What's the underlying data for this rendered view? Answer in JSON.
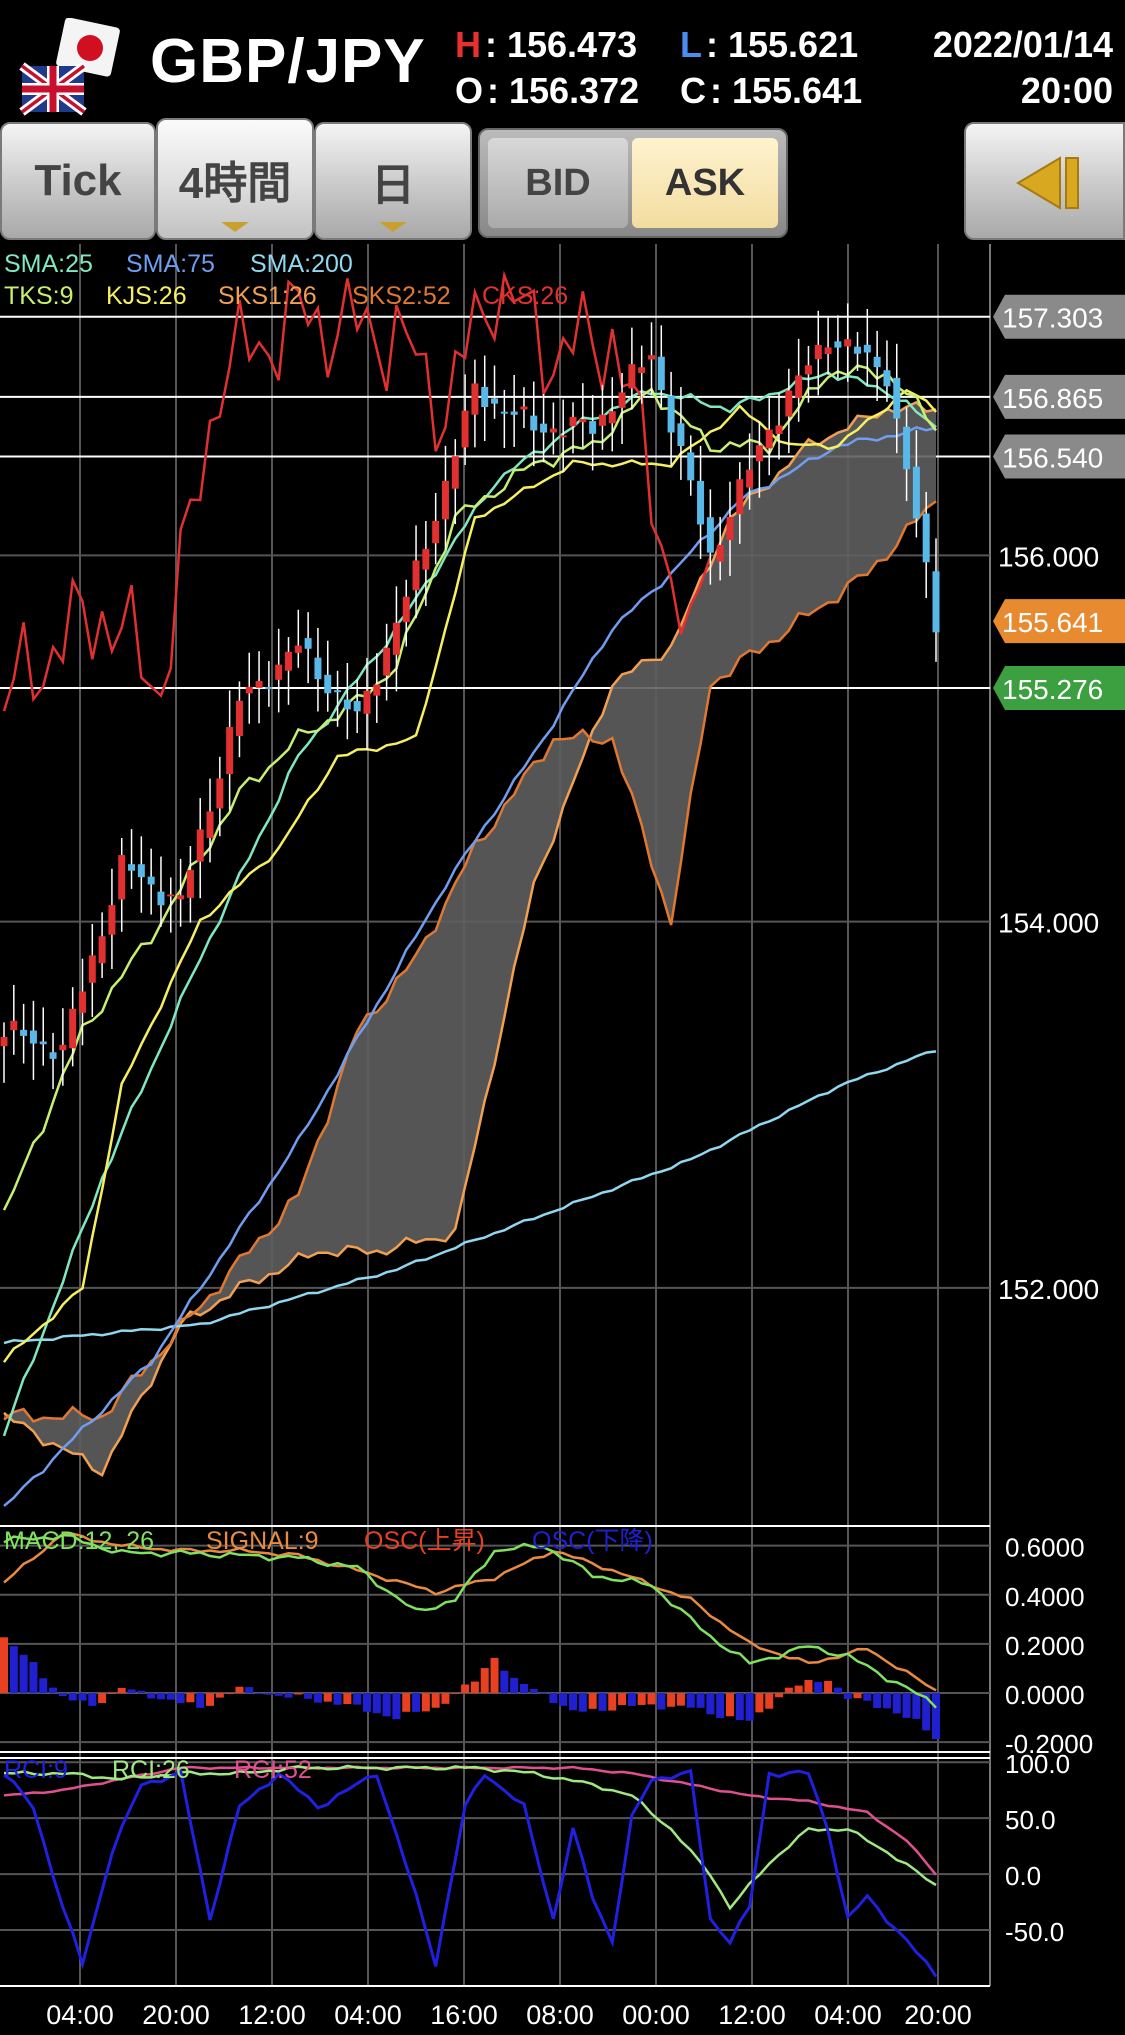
{
  "header": {
    "pair": "GBP/JPY",
    "high_key": "H",
    "high": ": 156.473",
    "low_key": "L",
    "low": ": 155.621",
    "open_key": "O",
    "open": ": 156.372",
    "close_key": "C",
    "close": ": 155.641",
    "date": "2022/01/14",
    "time": "20:00"
  },
  "toolbar": {
    "tabs": [
      "Tick",
      "4時間",
      "日"
    ],
    "selected_tab": "4時間",
    "bid_label": "BID",
    "ask_label": "ASK",
    "selected_side": "ASK"
  },
  "colors": {
    "sma25": "#7fe8c0",
    "sma75": "#6f9df0",
    "sma200": "#8fd8f0",
    "tks": "#c8f070",
    "kjs": "#f6f060",
    "sks1": "#f0a050",
    "sks2": "#e07830",
    "cks": "#e03030",
    "candle_up": "#e03030",
    "candle_down": "#58b8e8",
    "macd": "#80e060",
    "signal": "#e88a40",
    "osc_up": "#e84020",
    "osc_down": "#2020d0",
    "rci9": "#2020e0",
    "rci26": "#a0e880",
    "rci52": "#e05090",
    "close_tag": "#e88a30",
    "low_tag": "#3ca040"
  },
  "chart_data": [
    {
      "type": "candlestick",
      "title": "",
      "indicators_row1": [
        "SMA:25",
        "SMA:75",
        "SMA:200"
      ],
      "indicators_row2": [
        "TKS:9",
        "KJS:26",
        "SKS1:26",
        "SKS2:52",
        "CKS:26"
      ],
      "x_ticks": [
        "04:00",
        "20:00",
        "12:00",
        "04:00",
        "16:00",
        "08:00",
        "00:00",
        "12:00",
        "04:00",
        "20:00"
      ],
      "y_ticks": [
        "154.000",
        "152.000"
      ],
      "ylim": [
        150.7,
        157.7
      ],
      "price_tags": [
        {
          "label": "157.303",
          "value": 157.303,
          "style": "gray"
        },
        {
          "label": "156.865",
          "value": 156.865,
          "style": "gray"
        },
        {
          "label": "156.540",
          "value": 156.54,
          "style": "gray"
        },
        {
          "label": "156.000",
          "value": 156.0,
          "style": "plain"
        },
        {
          "label": "155.641",
          "value": 155.641,
          "style": "close"
        },
        {
          "label": "155.276",
          "value": 155.276,
          "style": "low"
        }
      ],
      "hlines": [
        157.303,
        156.865,
        156.54,
        155.276
      ],
      "anchors": {
        "close": [
          [
            0,
            153.4
          ],
          [
            6,
            153.3
          ],
          [
            12,
            154.3
          ],
          [
            18,
            154.1
          ],
          [
            24,
            155.2
          ],
          [
            30,
            155.5
          ],
          [
            36,
            155.1
          ],
          [
            42,
            155.9
          ],
          [
            48,
            156.9
          ],
          [
            54,
            156.7
          ],
          [
            60,
            156.7
          ],
          [
            66,
            157.1
          ],
          [
            72,
            156.0
          ],
          [
            78,
            156.7
          ],
          [
            84,
            157.2
          ],
          [
            90,
            157.0
          ],
          [
            95,
            155.64
          ]
        ],
        "sma25": [
          [
            0,
            151.2
          ],
          [
            10,
            152.6
          ],
          [
            20,
            153.8
          ],
          [
            30,
            154.9
          ],
          [
            40,
            155.6
          ],
          [
            50,
            156.4
          ],
          [
            58,
            156.7
          ],
          [
            66,
            156.9
          ],
          [
            74,
            156.8
          ],
          [
            84,
            157.0
          ],
          [
            90,
            156.9
          ],
          [
            95,
            156.7
          ]
        ],
        "sma75": [
          [
            0,
            150.8
          ],
          [
            15,
            151.6
          ],
          [
            30,
            152.8
          ],
          [
            45,
            154.2
          ],
          [
            55,
            155.0
          ],
          [
            62,
            155.6
          ],
          [
            68,
            155.9
          ],
          [
            75,
            156.3
          ],
          [
            85,
            156.6
          ],
          [
            95,
            156.7
          ]
        ],
        "sma200": [
          [
            0,
            151.7
          ],
          [
            20,
            151.8
          ],
          [
            40,
            152.1
          ],
          [
            55,
            152.4
          ],
          [
            70,
            152.7
          ],
          [
            85,
            153.1
          ],
          [
            95,
            153.3
          ]
        ],
        "tks": [
          [
            0,
            152.4
          ],
          [
            8,
            153.4
          ],
          [
            16,
            154.0
          ],
          [
            24,
            154.7
          ],
          [
            30,
            155.0
          ],
          [
            36,
            155.2
          ],
          [
            40,
            155.4
          ],
          [
            46,
            156.2
          ],
          [
            54,
            156.5
          ],
          [
            60,
            156.6
          ],
          [
            66,
            156.9
          ],
          [
            72,
            156.6
          ],
          [
            78,
            156.6
          ],
          [
            84,
            157.0
          ],
          [
            90,
            157.0
          ],
          [
            95,
            156.7
          ]
        ],
        "kjs": [
          [
            0,
            151.6
          ],
          [
            8,
            152.0
          ],
          [
            12,
            153.1
          ],
          [
            20,
            154.0
          ],
          [
            28,
            154.4
          ],
          [
            34,
            154.9
          ],
          [
            42,
            155.0
          ],
          [
            48,
            156.2
          ],
          [
            58,
            156.5
          ],
          [
            68,
            156.5
          ],
          [
            75,
            156.8
          ],
          [
            80,
            156.6
          ],
          [
            85,
            156.6
          ],
          [
            92,
            156.9
          ],
          [
            95,
            156.8
          ]
        ],
        "sks1": [
          [
            0,
            151.3
          ],
          [
            10,
            151.0
          ],
          [
            18,
            151.8
          ],
          [
            24,
            152.0
          ],
          [
            32,
            152.2
          ],
          [
            38,
            152.2
          ],
          [
            46,
            152.3
          ],
          [
            54,
            154.2
          ],
          [
            62,
            155.3
          ],
          [
            68,
            155.5
          ],
          [
            74,
            156.2
          ],
          [
            82,
            156.6
          ],
          [
            90,
            156.8
          ],
          [
            95,
            156.8
          ]
        ],
        "sks2": [
          [
            0,
            151.3
          ],
          [
            10,
            151.3
          ],
          [
            20,
            151.9
          ],
          [
            30,
            152.5
          ],
          [
            36,
            153.4
          ],
          [
            42,
            153.8
          ],
          [
            48,
            154.4
          ],
          [
            56,
            155.0
          ],
          [
            62,
            155.0
          ],
          [
            68,
            154.0
          ],
          [
            72,
            155.3
          ],
          [
            80,
            155.6
          ],
          [
            88,
            155.9
          ],
          [
            95,
            156.3
          ]
        ],
        "cks": [
          [
            0,
            155.2
          ],
          [
            5,
            155.5
          ],
          [
            10,
            155.7
          ],
          [
            16,
            155.3
          ],
          [
            22,
            157.0
          ],
          [
            30,
            157.3
          ],
          [
            40,
            157.2
          ],
          [
            45,
            156.8
          ],
          [
            50,
            157.5
          ],
          [
            56,
            157.1
          ],
          [
            62,
            157.2
          ],
          [
            66,
            156.4
          ],
          [
            70,
            155.4
          ],
          [
            72,
            156.2
          ]
        ]
      }
    },
    {
      "type": "line+bar",
      "title": "",
      "legend": [
        "MACD:12, 26",
        "SIGNAL:9",
        "OSC(上昇)",
        "OSC(下降)"
      ],
      "y_ticks": [
        "0.6000",
        "0.4000",
        "0.2000",
        "0.0000",
        "-0.2000"
      ],
      "ylim": [
        -0.24,
        0.68
      ],
      "anchors": {
        "macd": [
          [
            0,
            0.62
          ],
          [
            6,
            0.64
          ],
          [
            12,
            0.57
          ],
          [
            18,
            0.57
          ],
          [
            24,
            0.56
          ],
          [
            30,
            0.55
          ],
          [
            36,
            0.51
          ],
          [
            42,
            0.33
          ],
          [
            46,
            0.38
          ],
          [
            50,
            0.58
          ],
          [
            55,
            0.6
          ],
          [
            60,
            0.48
          ],
          [
            66,
            0.44
          ],
          [
            72,
            0.23
          ],
          [
            76,
            0.12
          ],
          [
            82,
            0.19
          ],
          [
            86,
            0.15
          ],
          [
            92,
            0.02
          ],
          [
            95,
            -0.05
          ]
        ],
        "signal": [
          [
            0,
            0.45
          ],
          [
            6,
            0.65
          ],
          [
            12,
            0.6
          ],
          [
            18,
            0.58
          ],
          [
            24,
            0.58
          ],
          [
            30,
            0.56
          ],
          [
            36,
            0.5
          ],
          [
            44,
            0.41
          ],
          [
            50,
            0.47
          ],
          [
            56,
            0.58
          ],
          [
            62,
            0.5
          ],
          [
            70,
            0.38
          ],
          [
            76,
            0.2
          ],
          [
            82,
            0.12
          ],
          [
            88,
            0.18
          ],
          [
            95,
            0.01
          ]
        ],
        "osc": [
          [
            0,
            0.22
          ],
          [
            3,
            0.12
          ],
          [
            6,
            -0.02
          ],
          [
            9,
            -0.05
          ],
          [
            12,
            0.02
          ],
          [
            16,
            -0.02
          ],
          [
            20,
            -0.06
          ],
          [
            24,
            0.02
          ],
          [
            28,
            -0.01
          ],
          [
            34,
            -0.04
          ],
          [
            40,
            -0.1
          ],
          [
            44,
            -0.06
          ],
          [
            48,
            0.05
          ],
          [
            50,
            0.15
          ],
          [
            52,
            0.05
          ],
          [
            55,
            0.0
          ],
          [
            58,
            -0.08
          ],
          [
            62,
            -0.06
          ],
          [
            66,
            -0.05
          ],
          [
            70,
            -0.06
          ],
          [
            74,
            -0.1
          ],
          [
            76,
            -0.12
          ],
          [
            80,
            0.02
          ],
          [
            84,
            0.06
          ],
          [
            86,
            -0.02
          ],
          [
            90,
            -0.06
          ],
          [
            93,
            -0.12
          ],
          [
            95,
            -0.18
          ]
        ]
      }
    },
    {
      "type": "line",
      "title": "",
      "legend": [
        "RCI:9",
        "RCI:26",
        "RCI:52"
      ],
      "y_ticks": [
        "100.0",
        "50.0",
        "0.0",
        "-50.0"
      ],
      "ylim": [
        -100,
        102
      ],
      "anchors": {
        "rci9": [
          [
            0,
            90
          ],
          [
            3,
            60
          ],
          [
            6,
            -30
          ],
          [
            8,
            -80
          ],
          [
            11,
            20
          ],
          [
            14,
            80
          ],
          [
            18,
            90
          ],
          [
            21,
            -40
          ],
          [
            24,
            60
          ],
          [
            28,
            90
          ],
          [
            32,
            60
          ],
          [
            36,
            80
          ],
          [
            38,
            90
          ],
          [
            42,
            -20
          ],
          [
            44,
            -80
          ],
          [
            47,
            60
          ],
          [
            49,
            90
          ],
          [
            53,
            60
          ],
          [
            56,
            -40
          ],
          [
            58,
            40
          ],
          [
            60,
            -20
          ],
          [
            62,
            -60
          ],
          [
            64,
            50
          ],
          [
            66,
            85
          ],
          [
            70,
            90
          ],
          [
            72,
            -40
          ],
          [
            74,
            -60
          ],
          [
            76,
            -30
          ],
          [
            78,
            90
          ],
          [
            82,
            90
          ],
          [
            84,
            40
          ],
          [
            86,
            -40
          ],
          [
            88,
            -20
          ],
          [
            92,
            -60
          ],
          [
            95,
            -90
          ]
        ],
        "rci26": [
          [
            0,
            90
          ],
          [
            6,
            90
          ],
          [
            12,
            85
          ],
          [
            18,
            90
          ],
          [
            24,
            90
          ],
          [
            30,
            95
          ],
          [
            36,
            95
          ],
          [
            42,
            95
          ],
          [
            48,
            95
          ],
          [
            54,
            90
          ],
          [
            60,
            80
          ],
          [
            64,
            70
          ],
          [
            68,
            40
          ],
          [
            72,
            0
          ],
          [
            74,
            -30
          ],
          [
            78,
            10
          ],
          [
            82,
            40
          ],
          [
            86,
            40
          ],
          [
            90,
            20
          ],
          [
            95,
            -10
          ]
        ],
        "rci52": [
          [
            0,
            70
          ],
          [
            6,
            75
          ],
          [
            12,
            85
          ],
          [
            18,
            95
          ],
          [
            30,
            95
          ],
          [
            40,
            95
          ],
          [
            50,
            95
          ],
          [
            58,
            95
          ],
          [
            64,
            90
          ],
          [
            70,
            80
          ],
          [
            76,
            70
          ],
          [
            82,
            65
          ],
          [
            88,
            55
          ],
          [
            92,
            30
          ],
          [
            95,
            0
          ]
        ]
      }
    }
  ]
}
